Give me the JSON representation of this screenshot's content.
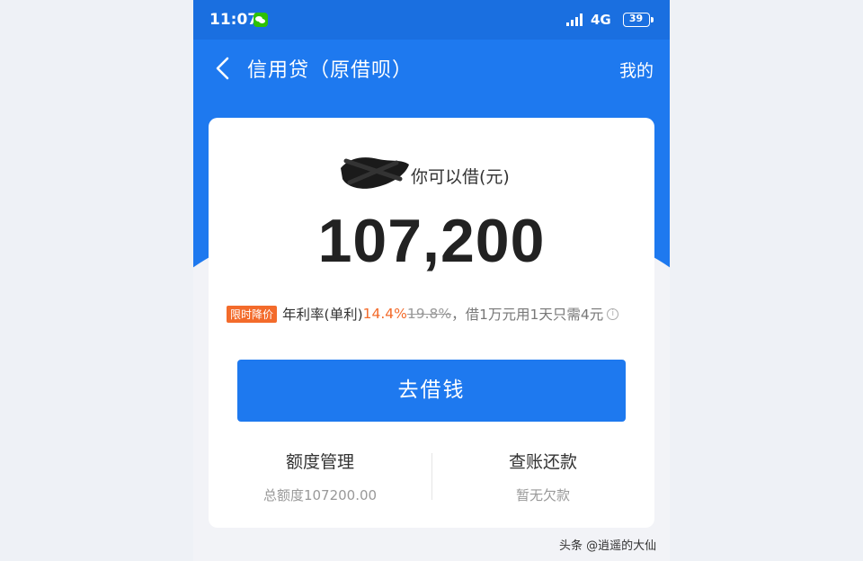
{
  "status_bar": {
    "time": "11:07",
    "network": "4G",
    "battery": "39"
  },
  "nav": {
    "title": "信用贷（原借呗）",
    "right_link": "我的"
  },
  "card": {
    "can_borrow_label": "你可以借(元)",
    "amount": "107,200",
    "rate_row": {
      "promo_badge": "限时降价",
      "rate_label": "年利率(单利)",
      "rate_new": "14.4%",
      "rate_old": "19.8%",
      "rate_note": "，借1万元用1天只需4元"
    },
    "borrow_button": "去借钱",
    "quota": {
      "title": "额度管理",
      "subtitle": "总额度107200.00"
    },
    "repay": {
      "title": "查账还款",
      "subtitle": "暂无欠款"
    }
  },
  "watermark": "头条 @逍遥的大仙",
  "colors": {
    "primary": "#1e79ef",
    "accent": "#f36b2b"
  }
}
